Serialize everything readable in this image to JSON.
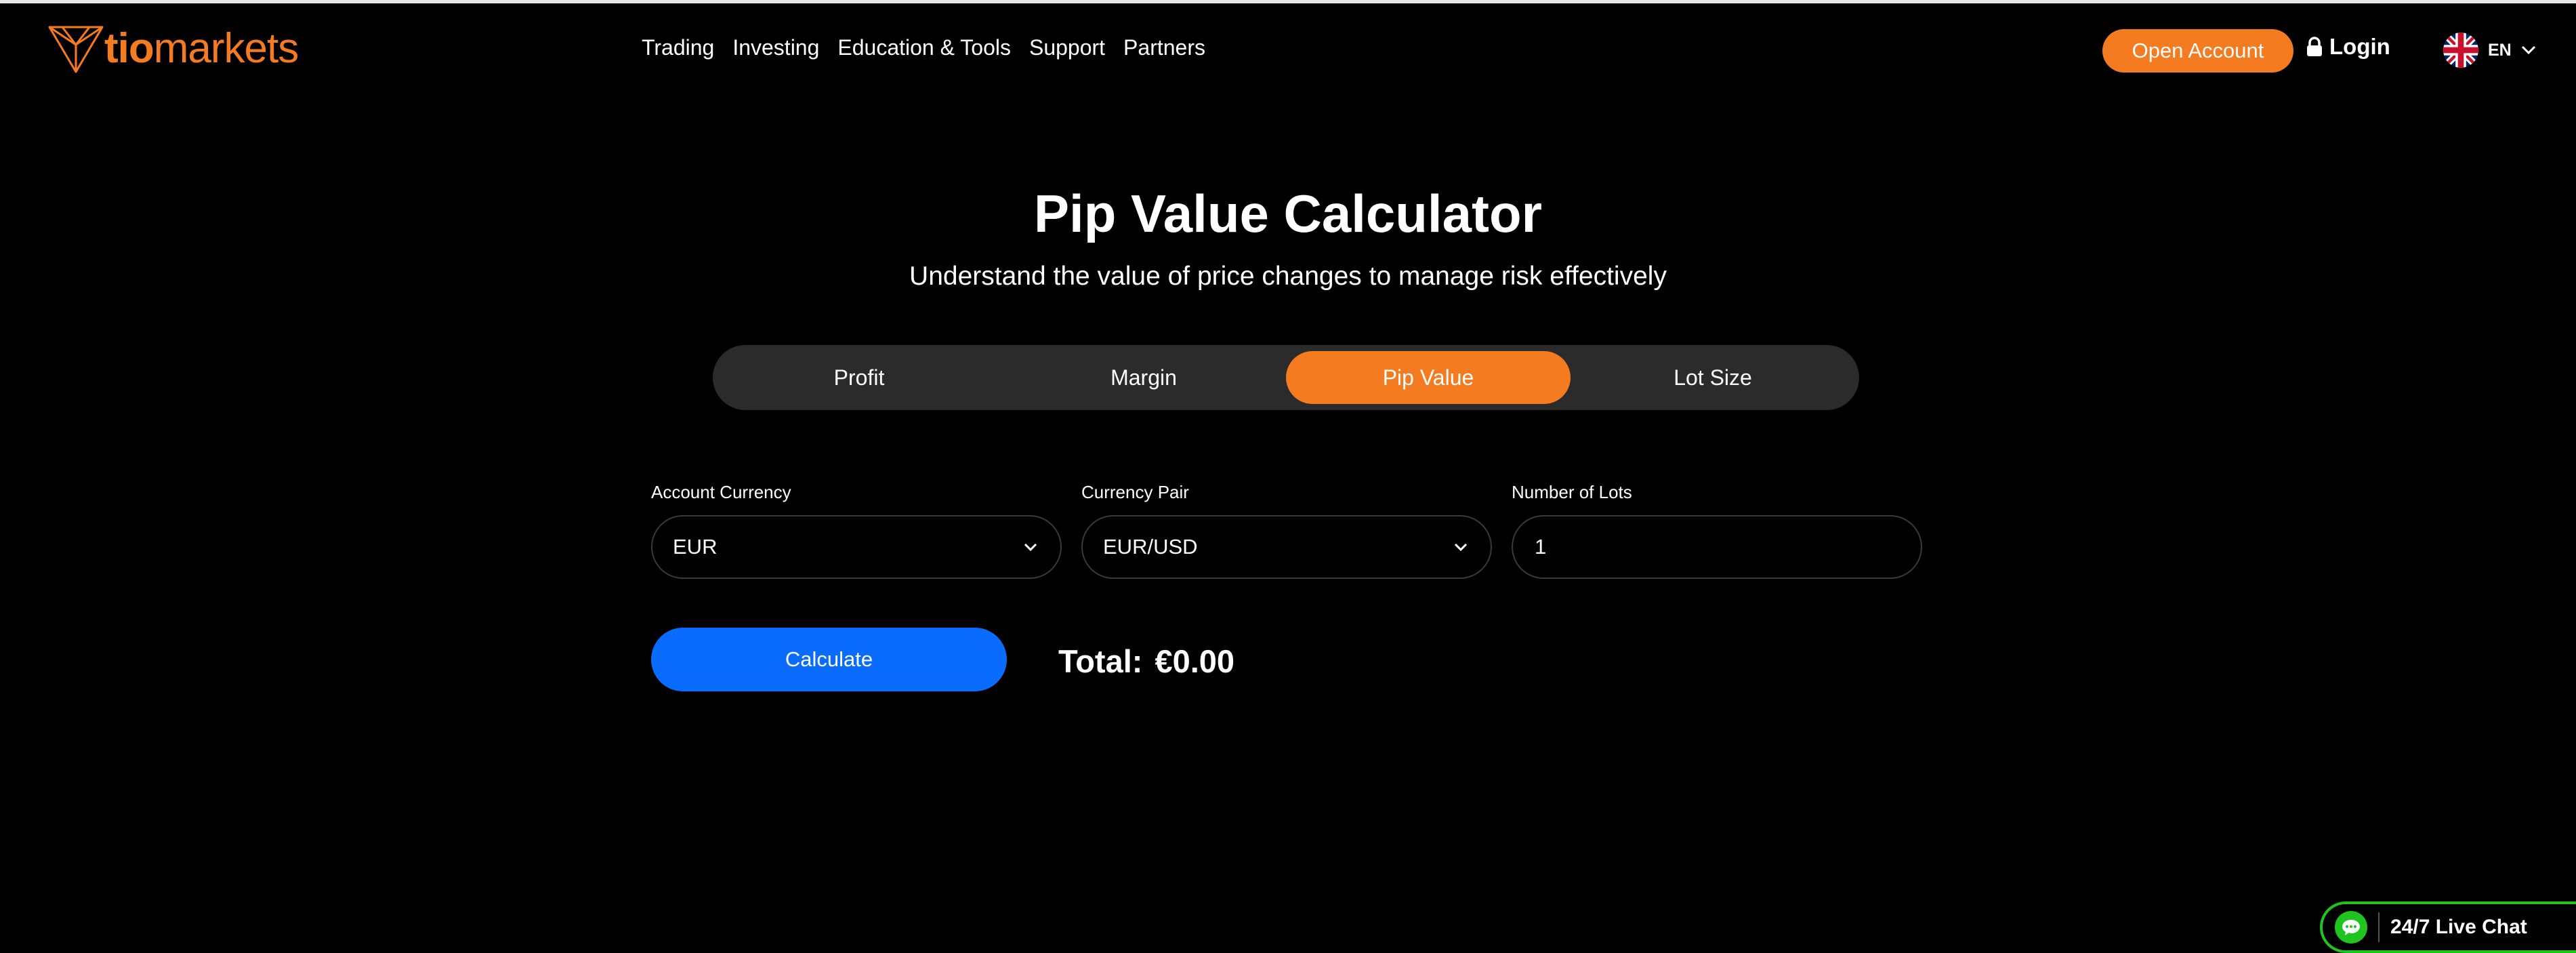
{
  "brand": {
    "name_light": "tio",
    "name_rest": "markets",
    "accent": "#f47b20"
  },
  "nav": {
    "items": [
      "Trading",
      "Investing",
      "Education & Tools",
      "Support",
      "Partners"
    ]
  },
  "header": {
    "open_account": "Open Account",
    "login": "Login",
    "language": "EN",
    "language_icon": "uk-flag-icon"
  },
  "hero": {
    "title": "Pip Value Calculator",
    "subtitle": "Understand the value of price changes to manage risk effectively"
  },
  "tabs": [
    {
      "label": "Profit",
      "active": false
    },
    {
      "label": "Margin",
      "active": false
    },
    {
      "label": "Pip Value",
      "active": true
    },
    {
      "label": "Lot Size",
      "active": false
    }
  ],
  "form": {
    "account_currency": {
      "label": "Account Currency",
      "value": "EUR"
    },
    "currency_pair": {
      "label": "Currency Pair",
      "value": "EUR/USD"
    },
    "lots": {
      "label": "Number of Lots",
      "value": "1"
    },
    "calculate_label": "Calculate",
    "calculate_color": "#0a6cff"
  },
  "result": {
    "label": "Total:",
    "value": "€0.00"
  },
  "chat": {
    "label": "24/7 Live Chat",
    "color": "#1fc41f"
  }
}
